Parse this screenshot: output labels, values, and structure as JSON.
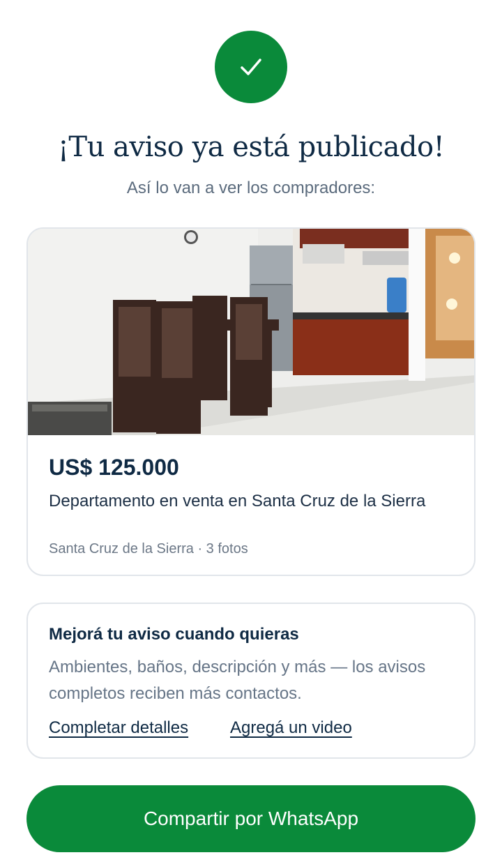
{
  "header": {
    "icon": "check-icon",
    "title": "¡Tu aviso ya está publicado!",
    "subtitle": "Así lo van a ver los compradores:"
  },
  "listing": {
    "price": "US$ 125.000",
    "title": "Departamento en venta en Santa Cruz de la Sierra",
    "meta": "Santa Cruz de la Sierra · 3 fotos",
    "photo_icon": "listing-photo"
  },
  "improve": {
    "title": "Mejorá tu aviso cuando quieras",
    "text": "Ambientes, baños, descripción y más — los avisos completos reciben más contactos.",
    "link_details": "Completar detalles",
    "link_video": "Agregá un video"
  },
  "actions": {
    "whatsapp_label": "Compartir por WhatsApp"
  },
  "colors": {
    "accent": "#0a8a3a",
    "text_primary": "#0f2a44",
    "text_secondary": "#667587"
  }
}
